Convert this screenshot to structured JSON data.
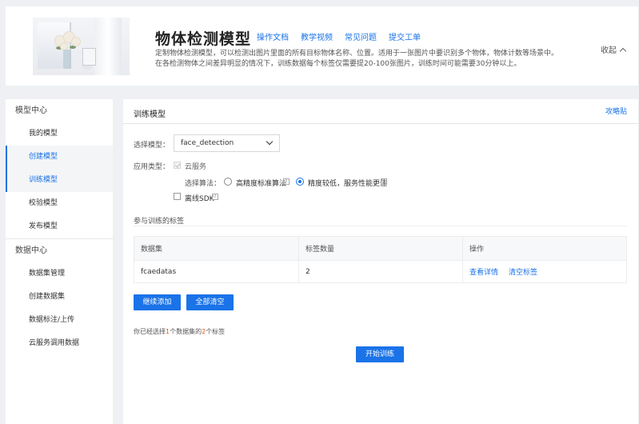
{
  "header": {
    "title": "物体检测模型",
    "links": [
      "操作文档",
      "教学视频",
      "常见问题",
      "提交工单"
    ],
    "desc_line1": "定制物体检测模型，可以检测出图片里面的所有目标物体名称、位置。适用于一张图片中要识别多个物体，物体计数等场景中。",
    "desc_line2": "在各检测物体之间差异明显的情况下，训练数据每个标签仅需要提20-100张图片，训练时间可能需要30分钟以上。",
    "collapse_label": "收起"
  },
  "sidebar": {
    "group_model": "模型中心",
    "model_items": [
      "我的模型",
      "创建模型",
      "训练模型",
      "校验模型",
      "发布模型"
    ],
    "group_data": "数据中心",
    "data_items": [
      "数据集管理",
      "创建数据集",
      "数据标注/上传",
      "云服务调用数据"
    ]
  },
  "main": {
    "title": "训练模型",
    "guide_link": "攻略贴",
    "select_model_label": "选择模型：",
    "select_model_value": "face_detection",
    "app_type_label": "应用类型：",
    "cloud_service_label": "云服务",
    "algo_label": "选择算法：",
    "algo_option1": "高精度标准算法",
    "algo_option2": "精度较低，服务性能更佳",
    "offline_sdk_label": "离线SDK",
    "help_mark": "?",
    "tags_section_label": "参与训练的标签",
    "table": {
      "headers": [
        "数据集",
        "标签数量",
        "操作"
      ],
      "rows": [
        {
          "dataset": "fcaedatas",
          "count": "2",
          "actions": [
            "查看详情",
            "清空标签"
          ]
        }
      ]
    },
    "btn_add": "继续添加",
    "btn_clear": "全部清空",
    "summary_prefix": "你已经选择",
    "summary_datasets": "1",
    "summary_middle": "个数据集的",
    "summary_tags": "2",
    "summary_suffix": "个标签",
    "btn_train": "开始训练"
  },
  "colors": {
    "accent": "#1a73e8",
    "highlight_number": "#e8541e",
    "page_bg": "#eef0f3"
  }
}
